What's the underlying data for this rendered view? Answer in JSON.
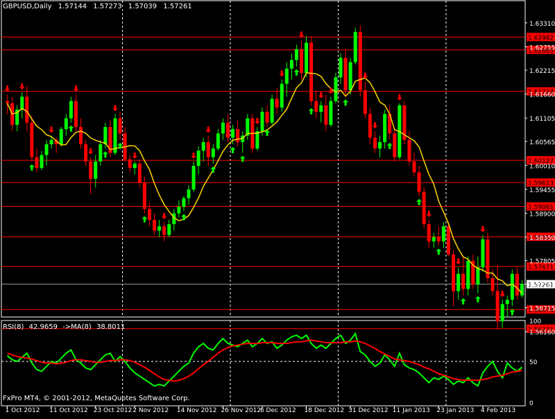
{
  "header": {
    "symbol": "GBPUSD,Daily",
    "open": "1.57144",
    "high": "1.57273",
    "low": "1.57039",
    "close": "1.57261"
  },
  "rsi_label": {
    "name": "RSI(8)",
    "value": "42.9659",
    "ma_label": "->MA(8)",
    "ma_value": "38.8011"
  },
  "copyright": "FxPro MT4, © 2001-2012, MetaQuotes Software Corp.",
  "colors": {
    "background": "#000000",
    "bull": "#00ff00",
    "bear": "#ff0000",
    "ma_line": "#ffd700",
    "rsi_line": "#00ff00",
    "rsi_ma_line": "#ff0000",
    "level_line": "#ff0000",
    "price_tag_bg": "#ff0000",
    "current_tag_bg": "#ffffff",
    "axis_text": "#ffffff",
    "up_arrow": "#00ff00",
    "down_arrow": "#ff0000"
  },
  "chart_data": [
    {
      "type": "candlestick",
      "title": "GBPUSD,Daily",
      "ylim": [
        1.565,
        1.6355
      ],
      "y_ticks": [
        "1.63310",
        "1.62755",
        "1.62215",
        "1.61660",
        "1.61105",
        "1.60565",
        "1.60010",
        "1.59455",
        "1.58900",
        "1.58350",
        "1.57805",
        "1.57261",
        "1.56715",
        "1.56160"
      ],
      "x_ticks": [
        "1 Oct 2012",
        "11 Oct 2012",
        "23 Oct 2012",
        "2 Nov 2012",
        "14 Nov 2012",
        "26 Nov 2012",
        "6 Dec 2012",
        "18 Dec 2012",
        "31 Dec 2012",
        "11 Jan 2013",
        "23 Jan 2013",
        "4 Feb 2013"
      ],
      "x_tick_bars": [
        0,
        9,
        18,
        26,
        35,
        44,
        52,
        61,
        70,
        79,
        88,
        97
      ],
      "separators_after_bars": [
        23,
        45,
        67,
        89
      ],
      "levels": [
        "1.62982",
        "1.62685",
        "1.61724",
        "1.60127",
        "1.59613",
        "1.59061",
        "1.58357",
        "1.57671",
        "1.56674",
        "1.56231"
      ],
      "current_price": "1.57261",
      "candles": [
        [
          1.615,
          1.6165,
          1.612,
          1.6145
        ],
        [
          1.6145,
          1.616,
          1.608,
          1.6095
        ],
        [
          1.6095,
          1.614,
          1.608,
          1.613
        ],
        [
          1.613,
          1.617,
          1.611,
          1.616
        ],
        [
          1.616,
          1.6185,
          1.608,
          1.61
        ],
        [
          1.61,
          1.6115,
          1.601,
          1.602
        ],
        [
          1.602,
          1.604,
          1.5985,
          1.5995
        ],
        [
          1.5995,
          1.6035,
          1.599,
          1.6025
        ],
        [
          1.6025,
          1.606,
          1.6,
          1.605
        ],
        [
          1.605,
          1.607,
          1.604,
          1.606
        ],
        [
          1.606,
          1.6065,
          1.603,
          1.605
        ],
        [
          1.605,
          1.609,
          1.6045,
          1.6085
        ],
        [
          1.6085,
          1.612,
          1.607,
          1.611
        ],
        [
          1.611,
          1.616,
          1.61,
          1.615
        ],
        [
          1.615,
          1.6165,
          1.608,
          1.609
        ],
        [
          1.609,
          1.611,
          1.604,
          1.605
        ],
        [
          1.605,
          1.606,
          1.6,
          1.601
        ],
        [
          1.601,
          1.602,
          1.5935,
          1.597
        ],
        [
          1.597,
          1.6025,
          1.595,
          1.601
        ],
        [
          1.601,
          1.606,
          1.6,
          1.605
        ],
        [
          1.605,
          1.61,
          1.604,
          1.609
        ],
        [
          1.609,
          1.6105,
          1.602,
          1.603
        ],
        [
          1.603,
          1.612,
          1.6025,
          1.611
        ],
        [
          1.611,
          1.6125,
          1.606,
          1.6075
        ],
        [
          1.6075,
          1.609,
          1.601,
          1.6015
        ],
        [
          1.6015,
          1.6025,
          1.5985,
          1.5995
        ],
        [
          1.5995,
          1.601,
          1.598,
          1.6005
        ],
        [
          1.6005,
          1.6015,
          1.595,
          1.596
        ],
        [
          1.596,
          1.5975,
          1.589,
          1.59
        ],
        [
          1.59,
          1.5915,
          1.586,
          1.5875
        ],
        [
          1.5875,
          1.589,
          1.584,
          1.585
        ],
        [
          1.585,
          1.5875,
          1.5835,
          1.586
        ],
        [
          1.586,
          1.587,
          1.5825,
          1.584
        ],
        [
          1.584,
          1.5875,
          1.5835,
          1.5865
        ],
        [
          1.5865,
          1.59,
          1.585,
          1.589
        ],
        [
          1.589,
          1.592,
          1.588,
          1.5905
        ],
        [
          1.5905,
          1.593,
          1.5895,
          1.5925
        ],
        [
          1.5925,
          1.5955,
          1.591,
          1.5945
        ],
        [
          1.5945,
          1.601,
          1.594,
          1.6
        ],
        [
          1.6,
          1.6045,
          1.598,
          1.6035
        ],
        [
          1.6035,
          1.6065,
          1.601,
          1.6055
        ],
        [
          1.6055,
          1.607,
          1.6,
          1.602
        ],
        [
          1.602,
          1.605,
          1.6005,
          1.604
        ],
        [
          1.604,
          1.6085,
          1.6035,
          1.6075
        ],
        [
          1.6075,
          1.611,
          1.606,
          1.61
        ],
        [
          1.61,
          1.612,
          1.6055,
          1.6065
        ],
        [
          1.6065,
          1.6095,
          1.605,
          1.6085
        ],
        [
          1.6085,
          1.6105,
          1.6045,
          1.6055
        ],
        [
          1.6055,
          1.608,
          1.603,
          1.607
        ],
        [
          1.607,
          1.612,
          1.606,
          1.611
        ],
        [
          1.611,
          1.612,
          1.603,
          1.604
        ],
        [
          1.604,
          1.609,
          1.6035,
          1.608
        ],
        [
          1.608,
          1.6135,
          1.607,
          1.6125
        ],
        [
          1.6125,
          1.614,
          1.609,
          1.61
        ],
        [
          1.61,
          1.6165,
          1.6095,
          1.6155
        ],
        [
          1.6155,
          1.618,
          1.612,
          1.6135
        ],
        [
          1.6135,
          1.62,
          1.6125,
          1.619
        ],
        [
          1.619,
          1.624,
          1.616,
          1.6225
        ],
        [
          1.6225,
          1.626,
          1.62,
          1.6245
        ],
        [
          1.6245,
          1.628,
          1.623,
          1.627
        ],
        [
          1.627,
          1.629,
          1.62,
          1.6215
        ],
        [
          1.6215,
          1.63,
          1.6205,
          1.6285
        ],
        [
          1.6285,
          1.63,
          1.614,
          1.615
        ],
        [
          1.615,
          1.6175,
          1.611,
          1.6125
        ],
        [
          1.6125,
          1.615,
          1.61,
          1.614
        ],
        [
          1.614,
          1.6165,
          1.608,
          1.6095
        ],
        [
          1.6095,
          1.616,
          1.609,
          1.615
        ],
        [
          1.615,
          1.6215,
          1.6145,
          1.6205
        ],
        [
          1.6205,
          1.626,
          1.619,
          1.625
        ],
        [
          1.625,
          1.627,
          1.616,
          1.6175
        ],
        [
          1.6175,
          1.625,
          1.6165,
          1.624
        ],
        [
          1.624,
          1.632,
          1.6235,
          1.631
        ],
        [
          1.631,
          1.6325,
          1.616,
          1.6175
        ],
        [
          1.6175,
          1.6195,
          1.611,
          1.612
        ],
        [
          1.612,
          1.6135,
          1.605,
          1.6065
        ],
        [
          1.6065,
          1.608,
          1.603,
          1.604
        ],
        [
          1.604,
          1.607,
          1.602,
          1.6055
        ],
        [
          1.6055,
          1.613,
          1.604,
          1.612
        ],
        [
          1.612,
          1.614,
          1.606,
          1.6075
        ],
        [
          1.6075,
          1.6085,
          1.601,
          1.602
        ],
        [
          1.602,
          1.6145,
          1.6015,
          1.614
        ],
        [
          1.614,
          1.615,
          1.605,
          1.606
        ],
        [
          1.606,
          1.608,
          1.6,
          1.601
        ],
        [
          1.601,
          1.603,
          1.5975,
          1.5985
        ],
        [
          1.5985,
          1.6,
          1.593,
          1.594
        ],
        [
          1.594,
          1.595,
          1.5855,
          1.5865
        ],
        [
          1.5865,
          1.5875,
          1.581,
          1.5825
        ],
        [
          1.5825,
          1.5845,
          1.581,
          1.5835
        ],
        [
          1.5835,
          1.586,
          1.5815,
          1.5825
        ],
        [
          1.5825,
          1.587,
          1.581,
          1.586
        ],
        [
          1.586,
          1.587,
          1.579,
          1.5795
        ],
        [
          1.5795,
          1.5805,
          1.5675,
          1.571
        ],
        [
          1.571,
          1.5765,
          1.569,
          1.575
        ],
        [
          1.575,
          1.579,
          1.57,
          1.5715
        ],
        [
          1.5715,
          1.579,
          1.57,
          1.578
        ],
        [
          1.578,
          1.5795,
          1.5715,
          1.5725
        ],
        [
          1.5725,
          1.579,
          1.5705,
          1.5765
        ],
        [
          1.5765,
          1.584,
          1.5755,
          1.583
        ],
        [
          1.583,
          1.5845,
          1.573,
          1.574
        ],
        [
          1.574,
          1.576,
          1.57,
          1.571
        ],
        [
          1.571,
          1.577,
          1.562,
          1.564
        ],
        [
          1.564,
          1.569,
          1.5625,
          1.568
        ],
        [
          1.568,
          1.57,
          1.565,
          1.569
        ],
        [
          1.569,
          1.576,
          1.5675,
          1.575
        ],
        [
          1.575,
          1.5765,
          1.569,
          1.57
        ],
        [
          1.57,
          1.5735,
          1.5695,
          1.5726
        ]
      ],
      "ma_period": 8,
      "up_arrow_bars": [
        5,
        13,
        20,
        23,
        28,
        36,
        42,
        46,
        48,
        53,
        59,
        62,
        69,
        78,
        84,
        88,
        93,
        96,
        103
      ],
      "down_arrow_bars": [
        0,
        3,
        9,
        14,
        17,
        22,
        26,
        32,
        38,
        41,
        51,
        56,
        60,
        64,
        66,
        73,
        75,
        80,
        86,
        92,
        97,
        101
      ]
    },
    {
      "type": "line",
      "title": "RSI(8) 42.9659 ->MA(8) 38.8011",
      "ylim": [
        0,
        100
      ],
      "y_ticks": [
        "100",
        "50",
        "0"
      ],
      "levels": [
        50
      ],
      "series": [
        {
          "name": "RSI(8)",
          "values": [
            57,
            52,
            50,
            55,
            60,
            48,
            40,
            38,
            44,
            50,
            48,
            54,
            60,
            64,
            52,
            48,
            42,
            40,
            46,
            52,
            58,
            60,
            50,
            56,
            50,
            42,
            36,
            32,
            28,
            24,
            20,
            22,
            20,
            26,
            32,
            38,
            44,
            48,
            60,
            68,
            72,
            66,
            64,
            72,
            78,
            72,
            70,
            68,
            72,
            76,
            68,
            72,
            78,
            72,
            74,
            66,
            70,
            76,
            80,
            82,
            78,
            82,
            72,
            66,
            70,
            66,
            72,
            78,
            82,
            72,
            76,
            84,
            62,
            58,
            50,
            44,
            48,
            58,
            52,
            44,
            60,
            46,
            42,
            40,
            36,
            30,
            24,
            30,
            28,
            32,
            28,
            22,
            26,
            24,
            30,
            24,
            20,
            36,
            44,
            50,
            38,
            30,
            48,
            42,
            38,
            43
          ]
        },
        {
          "name": "->MA(8)",
          "values": [
            60,
            58,
            56,
            55,
            54,
            53,
            51,
            49,
            48,
            48,
            47,
            48,
            49,
            51,
            52,
            52,
            51,
            50,
            49,
            49,
            50,
            51,
            51,
            52,
            52,
            51,
            49,
            46,
            43,
            39,
            35,
            31,
            28,
            27,
            26,
            27,
            29,
            32,
            36,
            41,
            46,
            50,
            55,
            60,
            64,
            67,
            69,
            70,
            71,
            72,
            72,
            72,
            73,
            73,
            73,
            72,
            72,
            72,
            73,
            74,
            74,
            75,
            76,
            75,
            74,
            73,
            73,
            73,
            73,
            74,
            74,
            75,
            74,
            72,
            69,
            66,
            62,
            59,
            56,
            53,
            52,
            51,
            50,
            48,
            46,
            43,
            41,
            38,
            35,
            33,
            31,
            29,
            28,
            27,
            27,
            27,
            27,
            28,
            29,
            31,
            32,
            33,
            35,
            37,
            38,
            39
          ]
        }
      ]
    }
  ]
}
